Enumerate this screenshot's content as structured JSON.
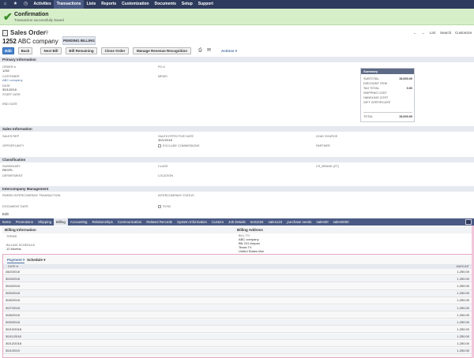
{
  "nav": {
    "items": [
      "Activities",
      "Transactions",
      "Lists",
      "Reports",
      "Customization",
      "Documents",
      "Setup",
      "Support"
    ],
    "active": "Transactions"
  },
  "confirmation": {
    "title": "Confirmation",
    "message": "Transaction successfully Saved"
  },
  "header": {
    "record_type": "Sales Order",
    "number": "1252",
    "customer_name": "ABC company",
    "status": "PENDING BILLING",
    "right_links": [
      "List",
      "Search",
      "Customize"
    ]
  },
  "buttons": {
    "edit": "Edit",
    "back": "Back",
    "next_bill": "Next Bill",
    "bill_remaining": "Bill Remaining",
    "close_order": "Close Order",
    "manage_revenue": "Manage Revenue Recognition",
    "actions": "Actions"
  },
  "primary": {
    "section": "Primary Information",
    "order_label": "ORDER #",
    "order_value": "1252",
    "po_label": "PO #",
    "customer_label": "CUSTOMER",
    "customer_value": "ABC company",
    "memo_label": "MEMO",
    "date_label": "DATE",
    "date_value": "30/1/2018",
    "start_label": "START DATE",
    "end_label": "END DATE"
  },
  "summary": {
    "title": "Summary",
    "rows": [
      {
        "label": "SUBTOTAL",
        "value": "15,000.00"
      },
      {
        "label": "DISCOUNT ITEM",
        "value": ""
      },
      {
        "label": "TAX TOTAL",
        "value": "0.00"
      },
      {
        "label": "SHIPPING COST",
        "value": ""
      },
      {
        "label": "HANDLING COST",
        "value": ""
      },
      {
        "label": "GIFT CERTIFICATE",
        "value": ""
      }
    ],
    "total_label": "TOTAL",
    "total_value": "15,000.00"
  },
  "sales": {
    "section": "Sales Information",
    "rep_label": "SALES REP",
    "eff_label": "SALES EFFECTIVE DATE",
    "eff_value": "30/1/2018",
    "lead_label": "LEAD SOURCE",
    "opp_label": "OPPORTUNITY",
    "excl_label": "EXCLUDE COMMISSIONS",
    "partner_label": "PARTNER"
  },
  "classification": {
    "section": "Classification",
    "sub_label": "SUBSIDIARY",
    "sub_value": "REGPL",
    "class_label": "CLASS",
    "cs_label": "CS_BRAND (ZT)",
    "dept_label": "DEPARTMENT",
    "loc_label": "LOCATION"
  },
  "intercompany": {
    "section": "Intercompany Management",
    "paired_label": "PAIRED INTERCOMPANY TRANSACTION",
    "status_label": "INTERCOMPANY STATUS",
    "doc_label": "DOCUMENT DATE",
    "sync_label": "SYNC"
  },
  "edit_link": "Edit",
  "subtabs": [
    "Items",
    "Promotions",
    "Shipping",
    "Billing",
    "Accounting",
    "Relationships",
    "Communication",
    "Related Records",
    "System Information",
    "Custom",
    "Job Details",
    "test1234",
    "sales123",
    "purchase needs",
    "sales00",
    "sales0000"
  ],
  "active_subtab": "Billing",
  "billing": {
    "info_title": "Billing Information",
    "address_title": "Billing Address",
    "terms_label": "TERMS",
    "schedule_label": "BILLING SCHEDULE",
    "schedule_value": "12 Months",
    "billto_label": "BILL TO",
    "billto_lines": [
      "ABC company",
      "Blk 231 Ampan",
      "Texas TX",
      "United States Mar"
    ]
  },
  "payment_schedule": {
    "tabs": [
      "Payment",
      "Schedule"
    ],
    "date_header": "DATE",
    "amount_header": "AMOUNT",
    "rows": [
      {
        "date": "28/2/2018",
        "amount": "1,250.00"
      },
      {
        "date": "30/3/2018",
        "amount": "1,250.00"
      },
      {
        "date": "30/4/2018",
        "amount": "1,250.00"
      },
      {
        "date": "30/5/2018",
        "amount": "1,250.00"
      },
      {
        "date": "30/6/2018",
        "amount": "1,250.00"
      },
      {
        "date": "30/7/2018",
        "amount": "1,250.00"
      },
      {
        "date": "30/8/2018",
        "amount": "1,250.00"
      },
      {
        "date": "30/9/2018",
        "amount": "1,250.00"
      },
      {
        "date": "30/10/2018",
        "amount": "1,250.00"
      },
      {
        "date": "30/11/2018",
        "amount": "1,250.00"
      },
      {
        "date": "30/12/2018",
        "amount": "1,250.00"
      },
      {
        "date": "30/1/2019",
        "amount": "1,250.00"
      }
    ]
  }
}
